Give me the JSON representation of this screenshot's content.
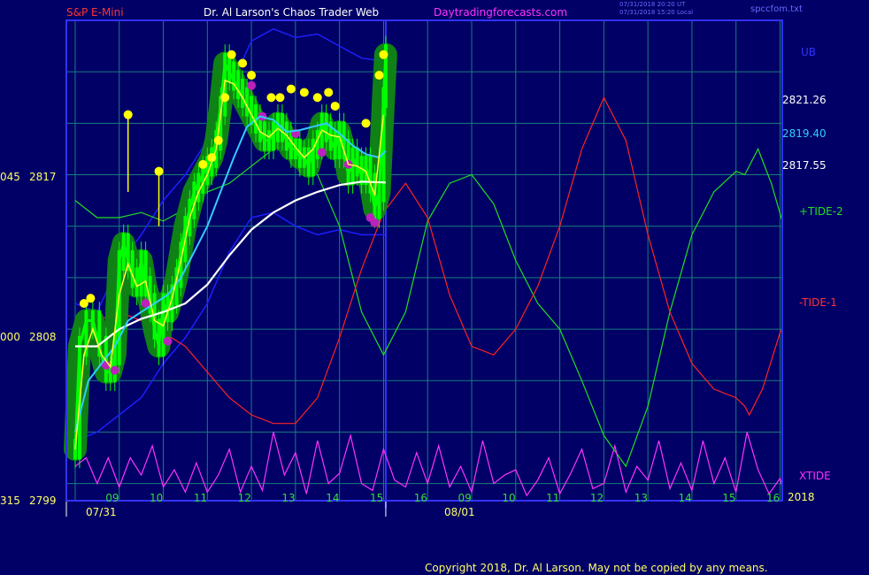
{
  "header": {
    "instrument": "S&P E-Mini",
    "site_name": "Dr. Al Larson's Chaos Trader Web",
    "site_url": "Daytradingforecasts.com",
    "timestamp_ut": "07/31/2018 20:20 UT",
    "timestamp_local": "07/31/2018 15:20 Local",
    "filename": "spccfom.txt"
  },
  "footer": {
    "copyright": "Copyright 2018, Dr. Al Larson. May not be copied by any means."
  },
  "colors": {
    "background": "#000066",
    "grid": "#1a7d7d",
    "frame": "#3232ff",
    "candles": "#00ff00",
    "ma_white": "#ffffff",
    "ma_cyan": "#33ccff",
    "ma_yellow": "#ffff33",
    "band": "#1e1eff",
    "tide2": "#22dd22",
    "tide1": "#ff2222",
    "xtide": "#ff33ff",
    "pivot_high": "#ffff00",
    "pivot_low": "#bb22bb"
  },
  "chart_data": {
    "type": "line",
    "title": "S&P E-Mini",
    "y_axis": {
      "range": [
        2799,
        2827
      ],
      "price_ticks": [
        2799,
        2808,
        2817
      ],
      "angle_ticks": [
        "315",
        "000",
        "045"
      ]
    },
    "x_axis": {
      "hour_labels": [
        "09",
        "10",
        "11",
        "12",
        "13",
        "14",
        "15",
        "16",
        "09",
        "10",
        "11",
        "12",
        "13",
        "14",
        "15",
        "16"
      ],
      "date_labels": [
        "07/31",
        "08/01"
      ],
      "year_label": "2018"
    },
    "right_labels": {
      "ub": "UB",
      "ub_value": "2821.26",
      "cyan_value": "2819.40",
      "white_value": "2817.55",
      "tide2": "+TIDE-2",
      "tide1": "-TIDE-1",
      "xtide": "XTIDE"
    },
    "series": [
      {
        "name": "price",
        "x": [
          0,
          0.1,
          0.25,
          0.4,
          0.55,
          0.7,
          0.8,
          0.9,
          1.0,
          1.1,
          1.2,
          1.3,
          1.4,
          1.5,
          1.6,
          1.7,
          1.8,
          1.9,
          2.0,
          2.1,
          2.2,
          2.3,
          2.4,
          2.5,
          2.6,
          2.7,
          2.8,
          2.9,
          3.0,
          3.1,
          3.2,
          3.3,
          3.4,
          3.5,
          3.6,
          3.7,
          3.8,
          3.9,
          4.0,
          4.1,
          4.2,
          4.3,
          4.4,
          4.5,
          4.6,
          4.7,
          4.8,
          4.9,
          5.0,
          5.1,
          5.2,
          5.3,
          5.4,
          5.5,
          5.6,
          5.7,
          5.8,
          5.9,
          6.0,
          6.1,
          6.2,
          6.3,
          6.4,
          6.5,
          6.6,
          6.7,
          6.8,
          6.9,
          7.0,
          7.05
        ],
        "values": [
          2802,
          2808,
          2809.5,
          2809.5,
          2808,
          2806.5,
          2806.5,
          2807.5,
          2813,
          2814,
          2813,
          2812,
          2811.5,
          2813,
          2811.5,
          2810.5,
          2809,
          2808,
          2810.5,
          2810,
          2811,
          2812,
          2813.5,
          2815,
          2816,
          2817,
          2817.5,
          2818,
          2818.5,
          2819,
          2820,
          2822,
          2824.5,
          2824,
          2823.5,
          2823,
          2822.5,
          2822,
          2821.5,
          2821,
          2820.5,
          2820,
          2820,
          2820.5,
          2821,
          2820.5,
          2820,
          2819.5,
          2819.5,
          2819,
          2819,
          2818.5,
          2819.5,
          2820,
          2821,
          2820.5,
          2820,
          2819.5,
          2820.5,
          2819.5,
          2818,
          2819,
          2818.5,
          2818,
          2818.5,
          2817.5,
          2816,
          2817,
          2822.5,
          2825
        ]
      },
      {
        "name": "ma_yellow",
        "x": [
          0,
          0.2,
          0.4,
          0.6,
          0.8,
          1.0,
          1.2,
          1.4,
          1.6,
          1.8,
          2.0,
          2.2,
          2.4,
          2.6,
          2.8,
          3.0,
          3.2,
          3.4,
          3.6,
          3.8,
          4.0,
          4.2,
          4.4,
          4.6,
          4.8,
          5.0,
          5.2,
          5.4,
          5.6,
          5.8,
          6.0,
          6.2,
          6.4,
          6.6,
          6.8,
          7.0
        ],
        "values": [
          2802,
          2807.5,
          2809,
          2807.5,
          2806.8,
          2811,
          2812.8,
          2811.5,
          2811.8,
          2809.5,
          2809.2,
          2810.8,
          2813,
          2815.5,
          2817,
          2818,
          2819.5,
          2823.5,
          2823.3,
          2822.5,
          2821.5,
          2820.5,
          2820.2,
          2820.7,
          2820.3,
          2819.6,
          2819,
          2819.5,
          2820.6,
          2820.3,
          2820.2,
          2818.6,
          2818.5,
          2818.2,
          2816.8,
          2821.5
        ]
      },
      {
        "name": "ma_cyan",
        "x": [
          0,
          0.3,
          0.6,
          0.9,
          1.2,
          1.5,
          1.8,
          2.1,
          2.4,
          2.7,
          3.0,
          3.3,
          3.6,
          3.9,
          4.2,
          4.5,
          4.8,
          5.1,
          5.4,
          5.7,
          6.0,
          6.3,
          6.6,
          6.9,
          7.05
        ],
        "values": [
          2803,
          2806,
          2807,
          2808,
          2809.5,
          2810,
          2810.5,
          2811,
          2812,
          2813.5,
          2815,
          2817,
          2819,
          2820.8,
          2821.4,
          2821.2,
          2820.5,
          2820.6,
          2820.8,
          2821,
          2820.4,
          2819.7,
          2819.2,
          2819,
          2819.4
        ]
      },
      {
        "name": "ma_white",
        "x": [
          0,
          0.5,
          1.0,
          1.5,
          2.0,
          2.5,
          3.0,
          3.5,
          4.0,
          4.5,
          5.0,
          5.5,
          6.0,
          6.5,
          7.05
        ],
        "values": [
          2808,
          2808,
          2809,
          2809.6,
          2810,
          2810.5,
          2811.6,
          2813.3,
          2814.8,
          2815.8,
          2816.5,
          2817,
          2817.4,
          2817.6,
          2817.55
        ]
      },
      {
        "name": "band_upper",
        "x": [
          0,
          0.5,
          1.0,
          1.5,
          2.0,
          2.5,
          3.0,
          3.5,
          4.0,
          4.5,
          5.0,
          5.5,
          6.0,
          6.5,
          7.05
        ],
        "values": [
          2810.5,
          2810,
          2812.8,
          2814.5,
          2816.5,
          2818,
          2820,
          2823,
          2825.8,
          2826.5,
          2826,
          2826.2,
          2825.5,
          2824.8,
          2824.6
        ]
      },
      {
        "name": "band_lower",
        "x": [
          0,
          0.5,
          1.0,
          1.5,
          2.0,
          2.5,
          3.0,
          3.5,
          4.0,
          4.5,
          5.0,
          5.5,
          6.0,
          6.5,
          7.05
        ],
        "values": [
          2802.5,
          2803,
          2804,
          2805,
          2807,
          2808.5,
          2810.5,
          2813.5,
          2815.5,
          2815.8,
          2815,
          2814.5,
          2814.8,
          2814.5,
          2814.5
        ]
      },
      {
        "name": "+TIDE-2",
        "x": [
          0,
          0.5,
          1.0,
          1.5,
          2.0,
          2.5,
          3.0,
          3.5,
          4.0,
          4.5,
          5.0,
          5.5,
          6.0,
          6.5,
          7.0,
          7.5,
          8.0,
          8.5,
          9.0,
          9.5,
          10.0,
          10.5,
          11.0,
          11.5,
          12.0,
          12.5,
          13.0,
          13.5,
          14.0,
          14.5,
          15.0,
          15.2,
          15.5,
          15.8,
          16.05
        ],
        "values": [
          2816.5,
          2815.5,
          2815.5,
          2815.8,
          2815.3,
          2816,
          2817,
          2817.5,
          2818.5,
          2819.5,
          2819.8,
          2818,
          2815,
          2810,
          2807.5,
          2810,
          2815.3,
          2817.5,
          2818,
          2816.3,
          2813,
          2810.5,
          2809,
          2806,
          2802.8,
          2801,
          2804.5,
          2810,
          2814.5,
          2817,
          2818.2,
          2818,
          2819.5,
          2817.5,
          2815.3
        ]
      },
      {
        "name": "-TIDE-1",
        "x": [
          0,
          0.5,
          1.0,
          1.5,
          2.0,
          2.5,
          3.0,
          3.5,
          4.0,
          4.5,
          5.0,
          5.5,
          6.0,
          6.5,
          7.0,
          7.5,
          8.0,
          8.5,
          9.0,
          9.5,
          10.0,
          10.5,
          11.0,
          11.5,
          12.0,
          12.5,
          13.0,
          13.5,
          14.0,
          14.5,
          15.0,
          15.2,
          15.3,
          15.6,
          16.0,
          16.05
        ],
        "values": [
          2808.5,
          2809.5,
          2810,
          2809.5,
          2808.8,
          2808,
          2806.5,
          2805,
          2804,
          2803.5,
          2803.5,
          2805,
          2808.5,
          2812.5,
          2815.8,
          2817.5,
          2815.5,
          2811,
          2808,
          2807.5,
          2809,
          2811.5,
          2815,
          2819.5,
          2822.5,
          2820,
          2814.5,
          2810,
          2807,
          2805.5,
          2805,
          2804.5,
          2804,
          2805.5,
          2808.8,
          2809
        ]
      },
      {
        "name": "XTIDE",
        "x": [
          0,
          0.25,
          0.5,
          0.75,
          1.0,
          1.25,
          1.5,
          1.75,
          2.0,
          2.25,
          2.5,
          2.75,
          3.0,
          3.25,
          3.5,
          3.75,
          4.0,
          4.25,
          4.5,
          4.75,
          5.0,
          5.25,
          5.5,
          5.75,
          6.0,
          6.25,
          6.5,
          6.75,
          7.0,
          7.25,
          7.5,
          7.75,
          8.0,
          8.25,
          8.5,
          8.75,
          9.0,
          9.25,
          9.5,
          9.75,
          10.0,
          10.25,
          10.5,
          10.75,
          11.0,
          11.25,
          11.5,
          11.75,
          12.0,
          12.25,
          12.5,
          12.75,
          13.0,
          13.25,
          13.5,
          13.75,
          14.0,
          14.25,
          14.5,
          14.75,
          15.0,
          15.25,
          15.5,
          15.75,
          16.0,
          16.05
        ],
        "values": [
          2801,
          2801.5,
          2800,
          2801.5,
          2799.8,
          2801.5,
          2800.5,
          2802.2,
          2799.8,
          2800.8,
          2799.5,
          2801.2,
          2799.5,
          2800.5,
          2802,
          2799.5,
          2801,
          2799.6,
          2803,
          2800.5,
          2801.8,
          2799.4,
          2802.5,
          2800,
          2800.6,
          2802.8,
          2800,
          2799.6,
          2802,
          2800.2,
          2799.8,
          2801.8,
          2800,
          2802.2,
          2799.8,
          2801,
          2799.5,
          2802.5,
          2800,
          2800.5,
          2800.8,
          2799.3,
          2800.2,
          2801.5,
          2799.4,
          2800.6,
          2802,
          2799.7,
          2800,
          2802.2,
          2799.5,
          2801,
          2800.2,
          2802.5,
          2799.7,
          2801.2,
          2799.6,
          2802.5,
          2800,
          2801.5,
          2799.5,
          2803,
          2800.8,
          2799.4,
          2800.3,
          2799.8
        ]
      }
    ],
    "pivots": {
      "highs_x": [
        0.2,
        0.35,
        1.2,
        1.9,
        2.9,
        3.1,
        3.25,
        3.4,
        3.55,
        3.8,
        4.0,
        4.45,
        4.65,
        4.9,
        5.2,
        5.5,
        5.75,
        5.9,
        6.6,
        6.9,
        7.0
      ],
      "highs_y": [
        2810.5,
        2810.8,
        2821.5,
        2818.2,
        2818.6,
        2819,
        2820,
        2822.5,
        2825,
        2824.5,
        2823.8,
        2822.5,
        2822.5,
        2823,
        2822.8,
        2822.5,
        2822.8,
        2822,
        2821,
        2823.8,
        2825
      ],
      "lows_x": [
        0.9,
        0.7,
        1.6,
        2.1,
        4.0,
        4.25,
        5.0,
        5.6,
        6.2,
        6.8,
        6.7
      ],
      "lows_y": [
        2806.6,
        2806.9,
        2810.5,
        2808.3,
        2823.2,
        2821.4,
        2820.4,
        2819.3,
        2818.6,
        2815.2,
        2815.5
      ]
    }
  }
}
